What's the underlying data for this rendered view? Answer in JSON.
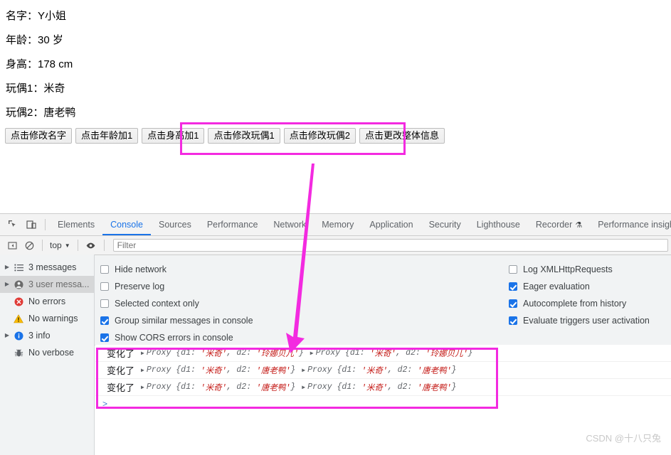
{
  "page": {
    "info_lines": [
      "名字：Y小姐",
      "年龄：30 岁",
      "身高：178 cm",
      "玩偶1：米奇",
      "玩偶2：唐老鸭"
    ],
    "buttons": [
      "点击修改名字",
      "点击年龄加1",
      "点击身高加1",
      "点击修改玩偶1",
      "点击修改玩偶2",
      "点击更改整体信息"
    ]
  },
  "annotations": {
    "accent_color": "#f32ae0",
    "arrow_from": "438,232",
    "arrow_to": "408,492"
  },
  "devtools": {
    "left_icons": [
      "inspect-element-icon",
      "device-toolbar-icon"
    ],
    "tabs": [
      {
        "label": "Elements",
        "active": false
      },
      {
        "label": "Console",
        "active": true
      },
      {
        "label": "Sources",
        "active": false
      },
      {
        "label": "Performance",
        "active": false
      },
      {
        "label": "Network",
        "active": false
      },
      {
        "label": "Memory",
        "active": false
      },
      {
        "label": "Application",
        "active": false
      },
      {
        "label": "Security",
        "active": false
      },
      {
        "label": "Lighthouse",
        "active": false
      },
      {
        "label": "Recorder",
        "active": false,
        "badge": "⚗"
      },
      {
        "label": "Performance insights",
        "active": false
      }
    ],
    "toolbar": {
      "sidebar_toggle": "sidebar-toggle-icon",
      "clear_console": "clear-console-icon",
      "context": "top",
      "eye": "live-expression-icon",
      "filter_placeholder": "Filter",
      "filter_value": ""
    },
    "settings_left": [
      {
        "label": "Hide network",
        "checked": false
      },
      {
        "label": "Preserve log",
        "checked": false
      },
      {
        "label": "Selected context only",
        "checked": false
      },
      {
        "label": "Group similar messages in console",
        "checked": true
      },
      {
        "label": "Show CORS errors in console",
        "checked": true
      }
    ],
    "settings_right": [
      {
        "label": "Log XMLHttpRequests",
        "checked": false
      },
      {
        "label": "Eager evaluation",
        "checked": true
      },
      {
        "label": "Autocomplete from history",
        "checked": true
      },
      {
        "label": "Evaluate triggers user activation",
        "checked": true
      }
    ],
    "sidebar": [
      {
        "label": "3 messages",
        "icon": "list-icon",
        "expandable": true,
        "selected": false
      },
      {
        "label": "3 user messa...",
        "icon": "user-icon",
        "expandable": true,
        "selected": true
      },
      {
        "label": "No errors",
        "icon": "error-icon",
        "expandable": false,
        "selected": false
      },
      {
        "label": "No warnings",
        "icon": "warning-icon",
        "expandable": false,
        "selected": false
      },
      {
        "label": "3 info",
        "icon": "info-icon",
        "expandable": true,
        "selected": false
      },
      {
        "label": "No verbose",
        "icon": "verbose-bug-icon",
        "expandable": false,
        "selected": false
      }
    ],
    "console_logs": [
      {
        "label": "变化了",
        "objects": [
          {
            "type": "Proxy",
            "d1": "米奇",
            "d2": "玲娜贝儿"
          },
          {
            "type": "Proxy",
            "d1": "米奇",
            "d2": "玲娜贝儿"
          }
        ]
      },
      {
        "label": "变化了",
        "objects": [
          {
            "type": "Proxy",
            "d1": "米奇",
            "d2": "唐老鸭"
          },
          {
            "type": "Proxy",
            "d1": "米奇",
            "d2": "唐老鸭"
          }
        ]
      },
      {
        "label": "变化了",
        "objects": [
          {
            "type": "Proxy",
            "d1": "米奇",
            "d2": "唐老鸭"
          },
          {
            "type": "Proxy",
            "d1": "米奇",
            "d2": "唐老鸭"
          }
        ]
      }
    ],
    "prompt_symbol": ">"
  },
  "watermark": "CSDN @十八只兔"
}
